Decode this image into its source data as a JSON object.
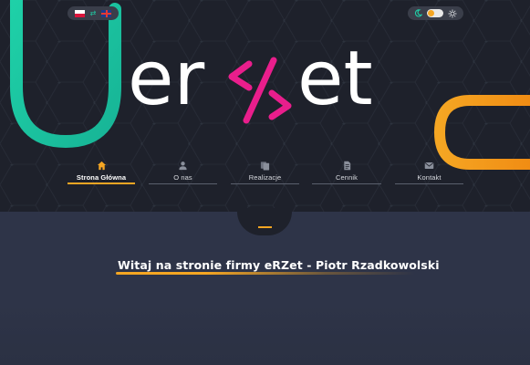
{
  "header": {
    "language_switch": {
      "languages": [
        "pl",
        "en"
      ],
      "swap_icon": "arrows-swap-icon"
    },
    "theme_switch": {
      "left_icon": "moon-icon",
      "right_icon": "sun-icon",
      "state": "light"
    },
    "logo": {
      "left_text": "er",
      "slash_text": "</>",
      "right_text": "et",
      "accent_color": "#e91e8c"
    }
  },
  "nav": {
    "items": [
      {
        "label": "Strona Główna",
        "icon": "home-icon",
        "active": true
      },
      {
        "label": "O nas",
        "icon": "user-icon",
        "active": false
      },
      {
        "label": "Realizacje",
        "icon": "files-icon",
        "active": false
      },
      {
        "label": "Cennik",
        "icon": "document-icon",
        "active": false
      },
      {
        "label": "Kontakt",
        "icon": "mail-icon",
        "active": false
      }
    ]
  },
  "main": {
    "heading": "Witaj na stronie firmy eRZet - Piotr Rzadkowolski"
  },
  "colors": {
    "hero_bg": "#1e212b",
    "content_bg": "#2e3448",
    "accent_orange": "#f5a623",
    "accent_teal": "#1fd1a8",
    "accent_pink": "#e91e8c",
    "nav_icon": "#8a8f9b"
  }
}
